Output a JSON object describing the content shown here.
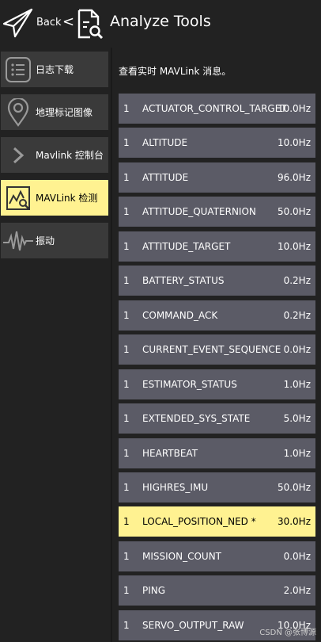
{
  "header": {
    "back_label": "Back",
    "separator": "<",
    "title": "Analyze Tools"
  },
  "sidebar": {
    "items": [
      {
        "label": "日志下载",
        "icon": "list-icon",
        "active": false
      },
      {
        "label": "地理标记图像",
        "icon": "map-pin-icon",
        "active": false
      },
      {
        "label": "Mavlink 控制台",
        "icon": "chevron-right-icon",
        "active": false
      },
      {
        "label": "MAVLink 检测",
        "icon": "chart-search-icon",
        "active": true
      },
      {
        "label": "振动",
        "icon": "waveform-icon",
        "active": false
      }
    ]
  },
  "main": {
    "hint": "查看实时 MAVLink 消息。",
    "messages": [
      {
        "id": "1",
        "name": "ACTUATOR_CONTROL_TARGET",
        "rate": "10.0Hz"
      },
      {
        "id": "1",
        "name": "ALTITUDE",
        "rate": "10.0Hz"
      },
      {
        "id": "1",
        "name": "ATTITUDE",
        "rate": "96.0Hz"
      },
      {
        "id": "1",
        "name": "ATTITUDE_QUATERNION",
        "rate": "50.0Hz"
      },
      {
        "id": "1",
        "name": "ATTITUDE_TARGET",
        "rate": "10.0Hz"
      },
      {
        "id": "1",
        "name": "BATTERY_STATUS",
        "rate": "0.2Hz"
      },
      {
        "id": "1",
        "name": "COMMAND_ACK",
        "rate": "0.2Hz"
      },
      {
        "id": "1",
        "name": "CURRENT_EVENT_SEQUENCE",
        "rate": "0.0Hz"
      },
      {
        "id": "1",
        "name": "ESTIMATOR_STATUS",
        "rate": "1.0Hz"
      },
      {
        "id": "1",
        "name": "EXTENDED_SYS_STATE",
        "rate": "5.0Hz"
      },
      {
        "id": "1",
        "name": "HEARTBEAT",
        "rate": "1.0Hz"
      },
      {
        "id": "1",
        "name": "HIGHRES_IMU",
        "rate": "50.0Hz"
      },
      {
        "id": "1",
        "name": "LOCAL_POSITION_NED *",
        "rate": "30.0Hz",
        "active": true
      },
      {
        "id": "1",
        "name": "MISSION_COUNT",
        "rate": "0.0Hz"
      },
      {
        "id": "1",
        "name": "PING",
        "rate": "2.0Hz"
      },
      {
        "id": "1",
        "name": "SERVO_OUTPUT_RAW",
        "rate": "10.0Hz"
      }
    ]
  },
  "watermark": "CSDN @张博源",
  "colors": {
    "background": "#222222",
    "item": "#3a3a3a",
    "row": "#5b5b66",
    "accent": "#fff291"
  }
}
